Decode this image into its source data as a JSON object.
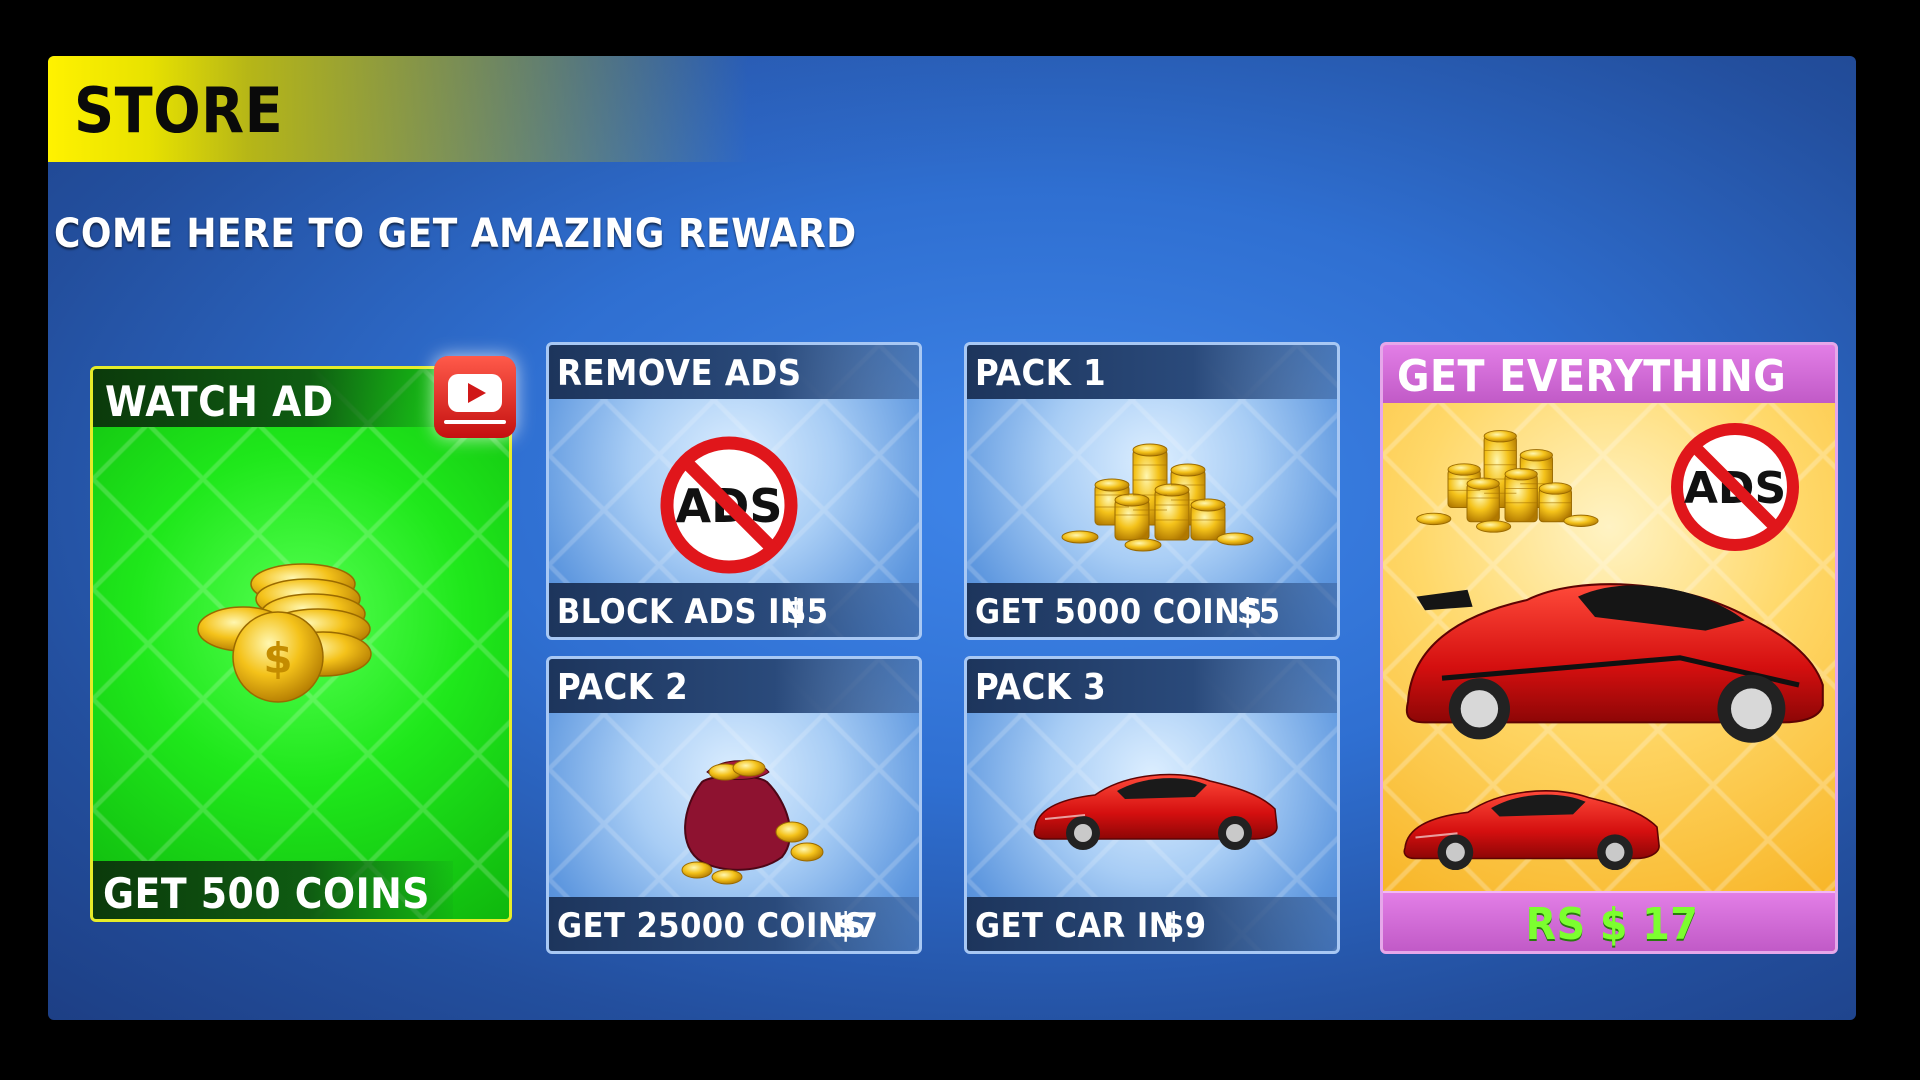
{
  "store": {
    "title": "STORE",
    "subtitle": "COME HERE TO GET AMAZING  REWARD"
  },
  "watch_ad": {
    "header": "WATCH AD",
    "footer": "GET 500 COINS",
    "icon": "youtube-play-icon"
  },
  "remove_ads": {
    "header": "REMOVE ADS",
    "footer": "BLOCK ADS IN",
    "price": "$5",
    "icon_text": "ADS"
  },
  "pack1": {
    "header": "PACK 1",
    "footer": "GET 5000 COINS",
    "price": "$5"
  },
  "pack2": {
    "header": "PACK 2",
    "footer": "GET 25000 COINS",
    "price": "$7"
  },
  "pack3": {
    "header": "PACK 3",
    "footer": "GET CAR IN",
    "price": "$9"
  },
  "everything": {
    "header": "GET EVERYTHING",
    "price": "RS $ 17",
    "icon_text": "ADS"
  },
  "colors": {
    "accent_yellow": "#fff200",
    "green_card": "#22e51f",
    "purple_header": "#d466d8",
    "price_green": "#7cff2f"
  }
}
